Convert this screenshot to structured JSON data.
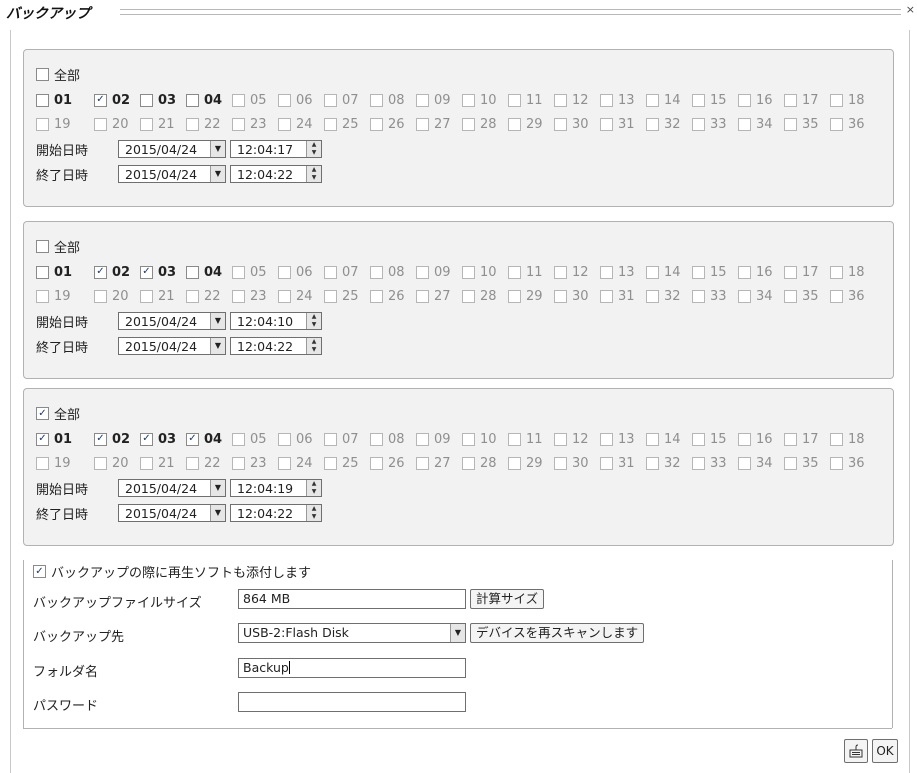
{
  "window": {
    "title": "バックアップ",
    "close_glyph": "×"
  },
  "groups": [
    {
      "all_label": "全部",
      "all_checked": false,
      "channels": [
        {
          "label": "01",
          "checked": false,
          "enabled": true
        },
        {
          "label": "02",
          "checked": true,
          "enabled": true
        },
        {
          "label": "03",
          "checked": false,
          "enabled": true
        },
        {
          "label": "04",
          "checked": false,
          "enabled": true
        },
        {
          "label": "05",
          "checked": false,
          "enabled": false
        },
        {
          "label": "06",
          "checked": false,
          "enabled": false
        },
        {
          "label": "07",
          "checked": false,
          "enabled": false
        },
        {
          "label": "08",
          "checked": false,
          "enabled": false
        },
        {
          "label": "09",
          "checked": false,
          "enabled": false
        },
        {
          "label": "10",
          "checked": false,
          "enabled": false
        },
        {
          "label": "11",
          "checked": false,
          "enabled": false
        },
        {
          "label": "12",
          "checked": false,
          "enabled": false
        },
        {
          "label": "13",
          "checked": false,
          "enabled": false
        },
        {
          "label": "14",
          "checked": false,
          "enabled": false
        },
        {
          "label": "15",
          "checked": false,
          "enabled": false
        },
        {
          "label": "16",
          "checked": false,
          "enabled": false
        },
        {
          "label": "17",
          "checked": false,
          "enabled": false
        },
        {
          "label": "18",
          "checked": false,
          "enabled": false
        },
        {
          "label": "19",
          "checked": false,
          "enabled": false
        },
        {
          "label": "20",
          "checked": false,
          "enabled": false
        },
        {
          "label": "21",
          "checked": false,
          "enabled": false
        },
        {
          "label": "22",
          "checked": false,
          "enabled": false
        },
        {
          "label": "23",
          "checked": false,
          "enabled": false
        },
        {
          "label": "24",
          "checked": false,
          "enabled": false
        },
        {
          "label": "25",
          "checked": false,
          "enabled": false
        },
        {
          "label": "26",
          "checked": false,
          "enabled": false
        },
        {
          "label": "27",
          "checked": false,
          "enabled": false
        },
        {
          "label": "28",
          "checked": false,
          "enabled": false
        },
        {
          "label": "29",
          "checked": false,
          "enabled": false
        },
        {
          "label": "30",
          "checked": false,
          "enabled": false
        },
        {
          "label": "31",
          "checked": false,
          "enabled": false
        },
        {
          "label": "32",
          "checked": false,
          "enabled": false
        },
        {
          "label": "33",
          "checked": false,
          "enabled": false
        },
        {
          "label": "34",
          "checked": false,
          "enabled": false
        },
        {
          "label": "35",
          "checked": false,
          "enabled": false
        },
        {
          "label": "36",
          "checked": false,
          "enabled": false
        }
      ],
      "start_label": "開始日時",
      "start_date": "2015/04/24",
      "start_time": "12:04:17",
      "end_label": "終了日時",
      "end_date": "2015/04/24",
      "end_time": "12:04:22"
    },
    {
      "all_label": "全部",
      "all_checked": false,
      "channels": [
        {
          "label": "01",
          "checked": false,
          "enabled": true
        },
        {
          "label": "02",
          "checked": true,
          "enabled": true
        },
        {
          "label": "03",
          "checked": true,
          "enabled": true
        },
        {
          "label": "04",
          "checked": false,
          "enabled": true
        },
        {
          "label": "05",
          "checked": false,
          "enabled": false
        },
        {
          "label": "06",
          "checked": false,
          "enabled": false
        },
        {
          "label": "07",
          "checked": false,
          "enabled": false
        },
        {
          "label": "08",
          "checked": false,
          "enabled": false
        },
        {
          "label": "09",
          "checked": false,
          "enabled": false
        },
        {
          "label": "10",
          "checked": false,
          "enabled": false
        },
        {
          "label": "11",
          "checked": false,
          "enabled": false
        },
        {
          "label": "12",
          "checked": false,
          "enabled": false
        },
        {
          "label": "13",
          "checked": false,
          "enabled": false
        },
        {
          "label": "14",
          "checked": false,
          "enabled": false
        },
        {
          "label": "15",
          "checked": false,
          "enabled": false
        },
        {
          "label": "16",
          "checked": false,
          "enabled": false
        },
        {
          "label": "17",
          "checked": false,
          "enabled": false
        },
        {
          "label": "18",
          "checked": false,
          "enabled": false
        },
        {
          "label": "19",
          "checked": false,
          "enabled": false
        },
        {
          "label": "20",
          "checked": false,
          "enabled": false
        },
        {
          "label": "21",
          "checked": false,
          "enabled": false
        },
        {
          "label": "22",
          "checked": false,
          "enabled": false
        },
        {
          "label": "23",
          "checked": false,
          "enabled": false
        },
        {
          "label": "24",
          "checked": false,
          "enabled": false
        },
        {
          "label": "25",
          "checked": false,
          "enabled": false
        },
        {
          "label": "26",
          "checked": false,
          "enabled": false
        },
        {
          "label": "27",
          "checked": false,
          "enabled": false
        },
        {
          "label": "28",
          "checked": false,
          "enabled": false
        },
        {
          "label": "29",
          "checked": false,
          "enabled": false
        },
        {
          "label": "30",
          "checked": false,
          "enabled": false
        },
        {
          "label": "31",
          "checked": false,
          "enabled": false
        },
        {
          "label": "32",
          "checked": false,
          "enabled": false
        },
        {
          "label": "33",
          "checked": false,
          "enabled": false
        },
        {
          "label": "34",
          "checked": false,
          "enabled": false
        },
        {
          "label": "35",
          "checked": false,
          "enabled": false
        },
        {
          "label": "36",
          "checked": false,
          "enabled": false
        }
      ],
      "start_label": "開始日時",
      "start_date": "2015/04/24",
      "start_time": "12:04:10",
      "end_label": "終了日時",
      "end_date": "2015/04/24",
      "end_time": "12:04:22"
    },
    {
      "all_label": "全部",
      "all_checked": true,
      "channels": [
        {
          "label": "01",
          "checked": true,
          "enabled": true
        },
        {
          "label": "02",
          "checked": true,
          "enabled": true
        },
        {
          "label": "03",
          "checked": true,
          "enabled": true
        },
        {
          "label": "04",
          "checked": true,
          "enabled": true
        },
        {
          "label": "05",
          "checked": false,
          "enabled": false
        },
        {
          "label": "06",
          "checked": false,
          "enabled": false
        },
        {
          "label": "07",
          "checked": false,
          "enabled": false
        },
        {
          "label": "08",
          "checked": false,
          "enabled": false
        },
        {
          "label": "09",
          "checked": false,
          "enabled": false
        },
        {
          "label": "10",
          "checked": false,
          "enabled": false
        },
        {
          "label": "11",
          "checked": false,
          "enabled": false
        },
        {
          "label": "12",
          "checked": false,
          "enabled": false
        },
        {
          "label": "13",
          "checked": false,
          "enabled": false
        },
        {
          "label": "14",
          "checked": false,
          "enabled": false
        },
        {
          "label": "15",
          "checked": false,
          "enabled": false
        },
        {
          "label": "16",
          "checked": false,
          "enabled": false
        },
        {
          "label": "17",
          "checked": false,
          "enabled": false
        },
        {
          "label": "18",
          "checked": false,
          "enabled": false
        },
        {
          "label": "19",
          "checked": false,
          "enabled": false
        },
        {
          "label": "20",
          "checked": false,
          "enabled": false
        },
        {
          "label": "21",
          "checked": false,
          "enabled": false
        },
        {
          "label": "22",
          "checked": false,
          "enabled": false
        },
        {
          "label": "23",
          "checked": false,
          "enabled": false
        },
        {
          "label": "24",
          "checked": false,
          "enabled": false
        },
        {
          "label": "25",
          "checked": false,
          "enabled": false
        },
        {
          "label": "26",
          "checked": false,
          "enabled": false
        },
        {
          "label": "27",
          "checked": false,
          "enabled": false
        },
        {
          "label": "28",
          "checked": false,
          "enabled": false
        },
        {
          "label": "29",
          "checked": false,
          "enabled": false
        },
        {
          "label": "30",
          "checked": false,
          "enabled": false
        },
        {
          "label": "31",
          "checked": false,
          "enabled": false
        },
        {
          "label": "32",
          "checked": false,
          "enabled": false
        },
        {
          "label": "33",
          "checked": false,
          "enabled": false
        },
        {
          "label": "34",
          "checked": false,
          "enabled": false
        },
        {
          "label": "35",
          "checked": false,
          "enabled": false
        },
        {
          "label": "36",
          "checked": false,
          "enabled": false
        }
      ],
      "start_label": "開始日時",
      "start_date": "2015/04/24",
      "start_time": "12:04:19",
      "end_label": "終了日時",
      "end_date": "2015/04/24",
      "end_time": "12:04:22"
    }
  ],
  "attach_player": {
    "label": "バックアップの際に再生ソフトも添付します",
    "checked": true
  },
  "file_size": {
    "label": "バックアップファイルサイズ",
    "value": "864 MB",
    "calc_button": "計算サイズ"
  },
  "destination": {
    "label": "バックアップ先",
    "value": "USB-2:Flash Disk",
    "rescan_button": "デバイスを再スキャンします"
  },
  "folder": {
    "label": "フォルダ名",
    "value": "Backup"
  },
  "password": {
    "label": "パスワード",
    "value": ""
  },
  "footer": {
    "ok_label": "OK",
    "keyboard_icon": "keyboard-icon"
  }
}
